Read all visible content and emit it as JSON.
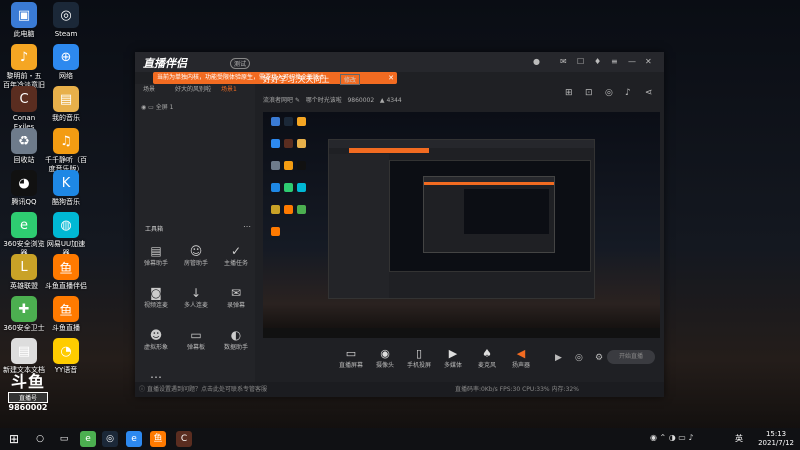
{
  "desktop": {
    "icons": [
      {
        "label": "此电脑",
        "icon": "computer-icon",
        "color": "#3a7bd5"
      },
      {
        "label": "Steam",
        "icon": "steam-icon",
        "color": "#1b2838"
      },
      {
        "label": "黎明前・五\n百年冷淡意旧",
        "icon": "game-icon",
        "color": "#f5a623"
      },
      {
        "label": "网络",
        "icon": "network-icon",
        "color": "#2d89ef"
      },
      {
        "label": "Conan\nExiles",
        "icon": "conan-icon",
        "color": "#5a2d20"
      },
      {
        "label": "我的音乐",
        "icon": "folder-icon",
        "color": "#e8b04a"
      },
      {
        "label": "回收站",
        "icon": "recycle-bin-icon",
        "color": "#6e7b8b"
      },
      {
        "label": "千千静听（百\n度音乐版）",
        "icon": "music-player-icon",
        "color": "#f39c12"
      },
      {
        "label": "腾讯QQ",
        "icon": "qq-icon",
        "color": "#111"
      },
      {
        "label": "酷狗音乐",
        "icon": "kugou-icon",
        "color": "#1e88e5"
      },
      {
        "label": "360安全浏览\n器",
        "icon": "360-browser-icon",
        "color": "#2ecc71"
      },
      {
        "label": "网易UU加速\n器",
        "icon": "uu-accelerator-icon",
        "color": "#00b8d4"
      },
      {
        "label": "英雄联盟",
        "icon": "lol-icon",
        "color": "#c9a227"
      },
      {
        "label": "斗鱼直播伴侣",
        "icon": "douyu-companion-icon",
        "color": "#ff7a00"
      },
      {
        "label": "360安全卫士",
        "icon": "360-security-icon",
        "color": "#4caf50"
      },
      {
        "label": "斗鱼直播",
        "icon": "douyu-live-icon",
        "color": "#ff7a00"
      },
      {
        "label": "新建文本文档",
        "icon": "text-file-icon",
        "color": "#ddd"
      },
      {
        "label": "YY语音",
        "icon": "yy-icon",
        "color": "#ffcc00"
      }
    ]
  },
  "app": {
    "title": "直播伴侣",
    "beta_label": "测试",
    "banner_text": "当前为单独内核，功能受限体验原生，需要接入可切换全新版本",
    "scene_tabs": [
      "场景",
      "好大的风别啦",
      "场景1"
    ],
    "scene_row_label": "全屏 1",
    "stream_title": "好好学习,天天向上",
    "edit_label": "修改",
    "stream_category": "流浪者网吧",
    "live_label": "哪个时光该啦",
    "room_id": "9860002",
    "viewer_count": "4344",
    "tools_title": "工具箱",
    "tools": [
      {
        "label": "弹幕助手",
        "icon": "danmu-icon"
      },
      {
        "label": "房管助手",
        "icon": "admin-icon"
      },
      {
        "label": "主播任务",
        "icon": "task-icon"
      },
      {
        "label": "视频连麦",
        "icon": "video-link-icon"
      },
      {
        "label": "多人连麦",
        "icon": "multi-link-icon"
      },
      {
        "label": "录弹幕",
        "icon": "record-danmu-icon"
      },
      {
        "label": "虚拟形象",
        "icon": "avatar-icon"
      },
      {
        "label": "弹幕板",
        "icon": "danmu-board-icon"
      },
      {
        "label": "数据助手",
        "icon": "data-icon"
      },
      {
        "label": "更多功能",
        "icon": "more-icon"
      }
    ],
    "controls": [
      {
        "label": "直播屏幕",
        "icon": "screen-icon"
      },
      {
        "label": "摄像头",
        "icon": "camera-icon"
      },
      {
        "label": "手机投屏",
        "icon": "phone-cast-icon"
      },
      {
        "label": "多媒体",
        "icon": "media-icon"
      },
      {
        "label": "麦克风",
        "icon": "mic-icon"
      },
      {
        "label": "扬声器",
        "icon": "speaker-icon"
      }
    ],
    "start_live_label": "开始直播",
    "bottom_tip": "直播设置遇到问题？点击此处可联系专管客服",
    "bottom_stats": "直播码率:0Kb/s    FPS:30    CPU:33%    内存:32%"
  },
  "watermark": {
    "logo": "斗鱼",
    "sub": "直播号",
    "id": "9860002"
  },
  "taskbar": {
    "time": "15:13",
    "date": "2021/7/12",
    "ime": "英"
  }
}
